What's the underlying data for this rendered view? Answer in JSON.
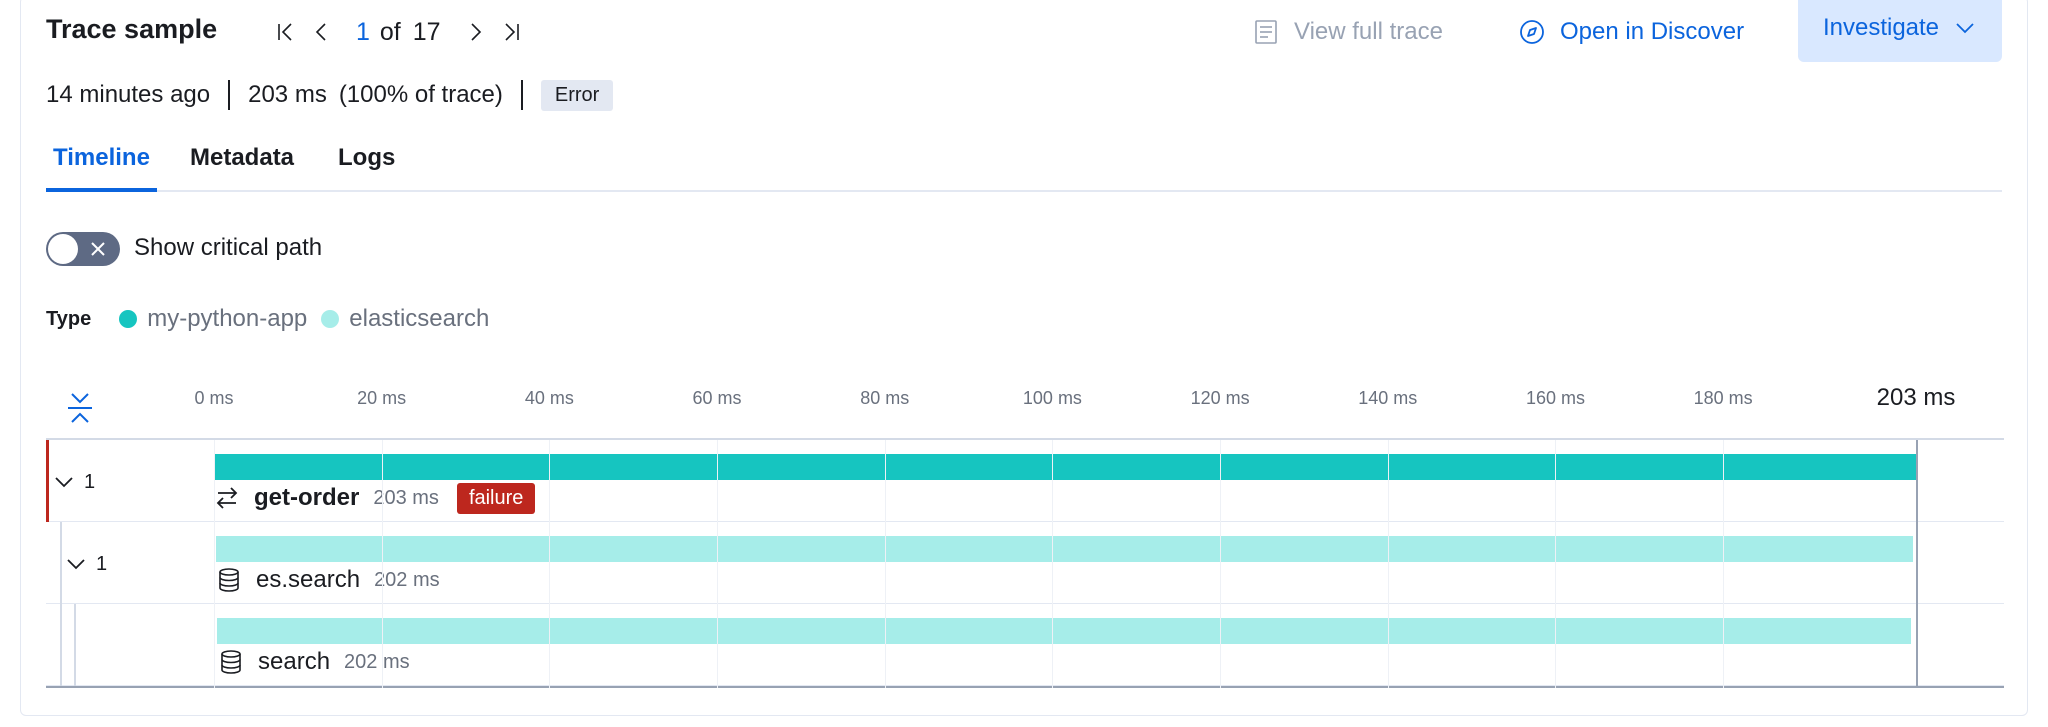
{
  "header": {
    "title": "Trace sample",
    "pager": {
      "current": "1",
      "of_label": "of",
      "total": "17"
    },
    "view_full_trace": "View full trace",
    "open_in_discover": "Open in Discover",
    "investigate": "Investigate"
  },
  "meta": {
    "age": "14 minutes ago",
    "duration": "203 ms",
    "percent": "(100% of trace)",
    "status_badge": "Error"
  },
  "tabs": [
    {
      "label": "Timeline",
      "active": true
    },
    {
      "label": "Metadata",
      "active": false
    },
    {
      "label": "Logs",
      "active": false
    }
  ],
  "critical_path": {
    "label": "Show critical path",
    "enabled": false
  },
  "legend": {
    "title": "Type",
    "items": [
      {
        "label": "my-python-app",
        "color": "#16c5c0"
      },
      {
        "label": "elasticsearch",
        "color": "#a6ede9"
      }
    ]
  },
  "timeline": {
    "ticks": [
      "0 ms",
      "20 ms",
      "40 ms",
      "60 ms",
      "80 ms",
      "100 ms",
      "120 ms",
      "140 ms",
      "160 ms",
      "180 ms"
    ],
    "end_label": "203 ms",
    "total_ms": 203,
    "spans": [
      {
        "name": "get-order",
        "duration": "203 ms",
        "start_ms": 0,
        "duration_ms": 203,
        "color": "#16c5c0",
        "icon": "transaction-icon",
        "children_count": "1",
        "badge": "failure",
        "error": true
      },
      {
        "name": "es.search",
        "duration": "202 ms",
        "start_ms": 0.2,
        "duration_ms": 202.4,
        "color": "#a6ede9",
        "icon": "database-icon",
        "children_count": "1",
        "badge": "",
        "error": false
      },
      {
        "name": "search",
        "duration": "202 ms",
        "start_ms": 0.4,
        "duration_ms": 202,
        "color": "#a6ede9",
        "icon": "database-icon",
        "children_count": "",
        "badge": "",
        "error": false
      }
    ]
  },
  "colors": {
    "accent": "#0b64dd",
    "failure": "#bd271e",
    "service_app": "#16c5c0",
    "service_es": "#a6ede9"
  }
}
